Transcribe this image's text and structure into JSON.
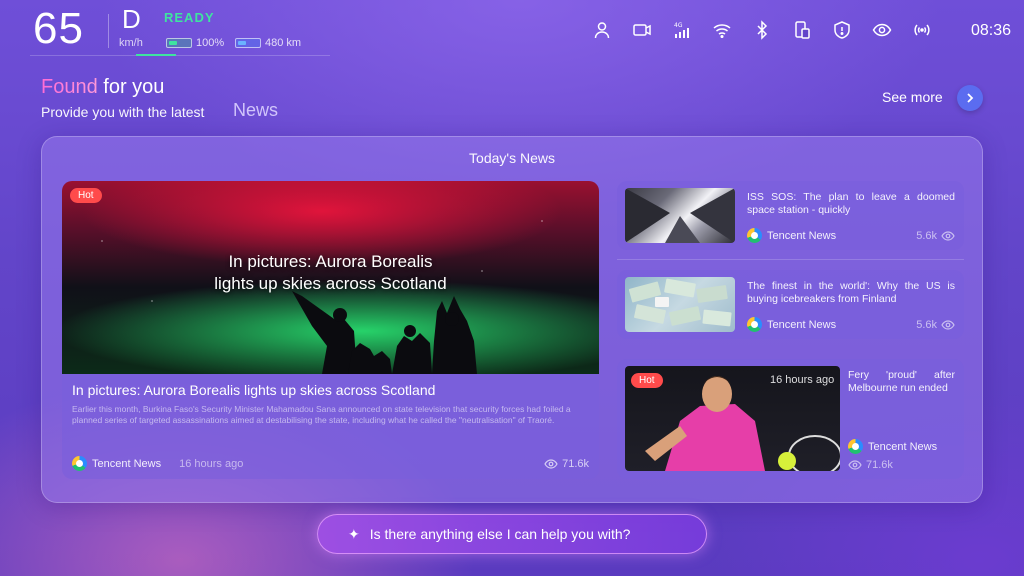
{
  "status": {
    "speed": "65",
    "speed_unit": "km/h",
    "gear": "D",
    "ready": "READY",
    "battery": "100%",
    "range": "480 km",
    "time": "08:36"
  },
  "header": {
    "title_highlight": "Found",
    "title_rest": " for you",
    "subtitle": "Provide you with the latest",
    "category": "News",
    "see_more": "See more"
  },
  "panel": {
    "title": "Today's News",
    "featured": {
      "badge": "Hot",
      "overlay_line1": "In pictures: Aurora Borealis",
      "overlay_line2": "lights up skies across Scotland",
      "headline": "In pictures: Aurora Borealis lights up skies across Scotland",
      "summary": "Earlier this month, Burkina Faso's Security Minister Mahamadou Sana announced on state television that security forces had foiled a planned series of targeted assassinations aimed at destabilising the state, including what he called the \"neutralisation\" of Traoré.",
      "source": "Tencent News",
      "time": "16 hours ago",
      "views": "71.6k"
    },
    "items": [
      {
        "title": "ISS SOS: The plan to leave a doomed space station - quickly",
        "source": "Tencent News",
        "views": "5.6k"
      },
      {
        "title": "The finest in the world': Why the US is buying icebreakers from Finland",
        "source": "Tencent News",
        "views": "5.6k"
      },
      {
        "badge": "Hot",
        "time": "16 hours ago",
        "title": "Fery 'proud' after Melbourne run ended",
        "source": "Tencent News",
        "views": "71.6k"
      }
    ]
  },
  "assistant": {
    "prompt": "Is there anything else I can help you with?"
  },
  "icons": [
    "user-icon",
    "camera-icon",
    "4g-signal-icon",
    "wifi-icon",
    "bluetooth-icon",
    "phone-connect-icon",
    "shield-icon",
    "eye-icon",
    "broadcast-icon"
  ],
  "colors": {
    "ready": "#3fe3a0",
    "hot": "#ff4b4b",
    "see_more_button": "#5b6cf0"
  }
}
